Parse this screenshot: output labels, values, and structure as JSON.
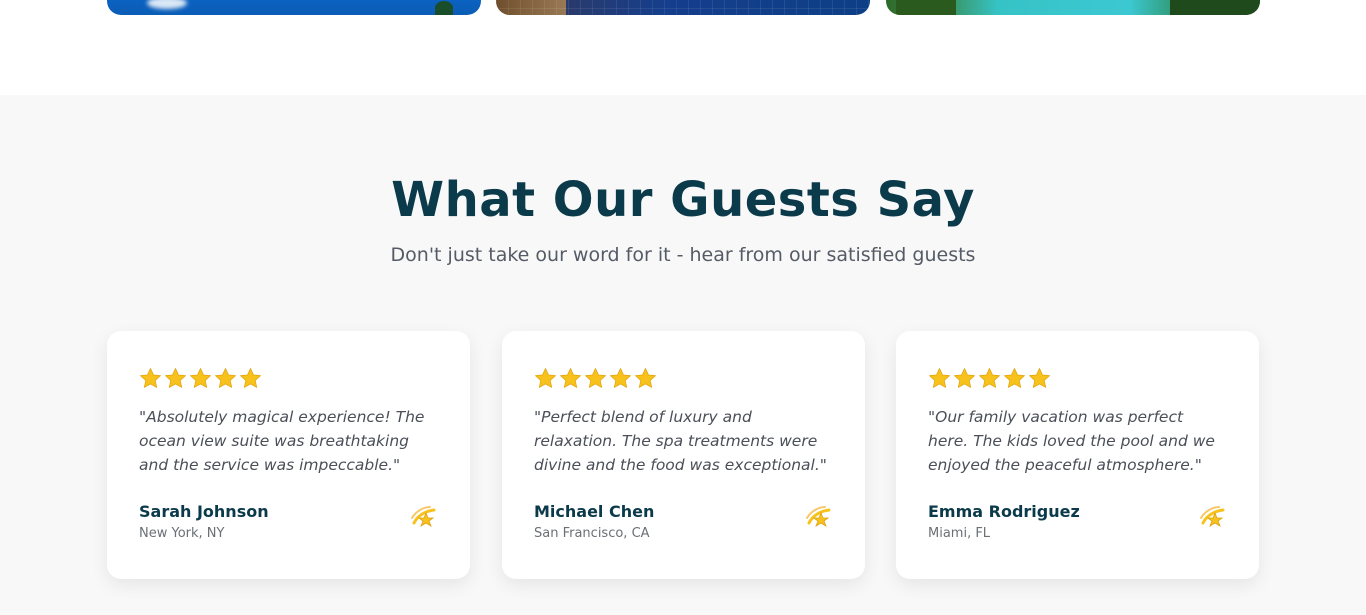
{
  "section": {
    "title": "What Our Guests Say",
    "subtitle": "Don't just take our word for it - hear from our satisfied guests"
  },
  "testimonials": [
    {
      "rating": 5,
      "quote": "\"Absolutely magical experience! The ocean view suite was breathtaking and the service was impeccable.\"",
      "name": "Sarah Johnson",
      "location": "New York, NY",
      "icon": "dizzy-star-icon"
    },
    {
      "rating": 5,
      "quote": "\"Perfect blend of luxury and relaxation. The spa treatments were divine and the food was exceptional.\"",
      "name": "Michael Chen",
      "location": "San Francisco, CA",
      "icon": "dizzy-star-icon"
    },
    {
      "rating": 5,
      "quote": "\"Our family vacation was perfect here. The kids loved the pool and we enjoyed the peaceful atmosphere.\"",
      "name": "Emma Rodriguez",
      "location": "Miami, FL",
      "icon": "dizzy-star-icon"
    }
  ],
  "colors": {
    "title": "#0b3a4b",
    "star": "#f7c21b",
    "section_bg": "#f8f8f8"
  }
}
